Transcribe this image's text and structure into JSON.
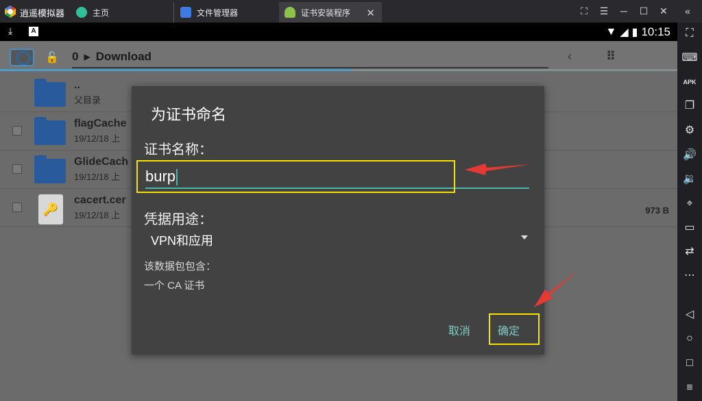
{
  "emulator": {
    "name": "逍遥模拟器",
    "tabs": [
      {
        "label": "主页",
        "icon": "home-tab-icon"
      },
      {
        "label": "文件管理器",
        "icon": "file-manager-tab-icon"
      },
      {
        "label": "证书安装程序",
        "icon": "android-tab-icon"
      }
    ],
    "window_controls": [
      "fullscreen",
      "menu",
      "minimize",
      "maximize",
      "close",
      "collapse"
    ]
  },
  "statusbar": {
    "time": "10:15",
    "indicators": [
      "download-icon",
      "a-icon"
    ]
  },
  "file_manager": {
    "path_root": "0",
    "path_current": "Download",
    "rows": [
      {
        "name": "..",
        "meta": "父目录",
        "type": "folder",
        "checkbox": false,
        "size": ""
      },
      {
        "name": "flagCache",
        "meta": "19/12/18 上",
        "type": "folder",
        "checkbox": true,
        "size": ""
      },
      {
        "name": "GlideCach",
        "meta": "19/12/18 上",
        "type": "folder",
        "checkbox": true,
        "size": ""
      },
      {
        "name": "cacert.cer",
        "meta": "19/12/18 上",
        "type": "certificate",
        "checkbox": true,
        "size": "973 B"
      }
    ]
  },
  "dialog": {
    "title": "为证书命名",
    "name_label": "证书名称：",
    "name_value": "burp",
    "usage_label": "凭据用途：",
    "usage_value": "VPN和应用",
    "contains_label": "该数据包包含：",
    "contains_item": "一个 CA 证书",
    "cancel_label": "取消",
    "ok_label": "确定"
  },
  "annotations": {
    "highlight_color": "#f5e400",
    "arrow_color": "#e53935"
  },
  "sidebar_icons": [
    "fullscreen-icon",
    "keyboard-icon",
    "apk-icon",
    "multi-window-icon",
    "settings-icon",
    "volume-up-icon",
    "volume-down-icon",
    "location-icon",
    "folder-icon",
    "rotate-icon",
    "more-icon",
    "back-icon",
    "home-icon",
    "recents-icon",
    "menu-icon"
  ]
}
